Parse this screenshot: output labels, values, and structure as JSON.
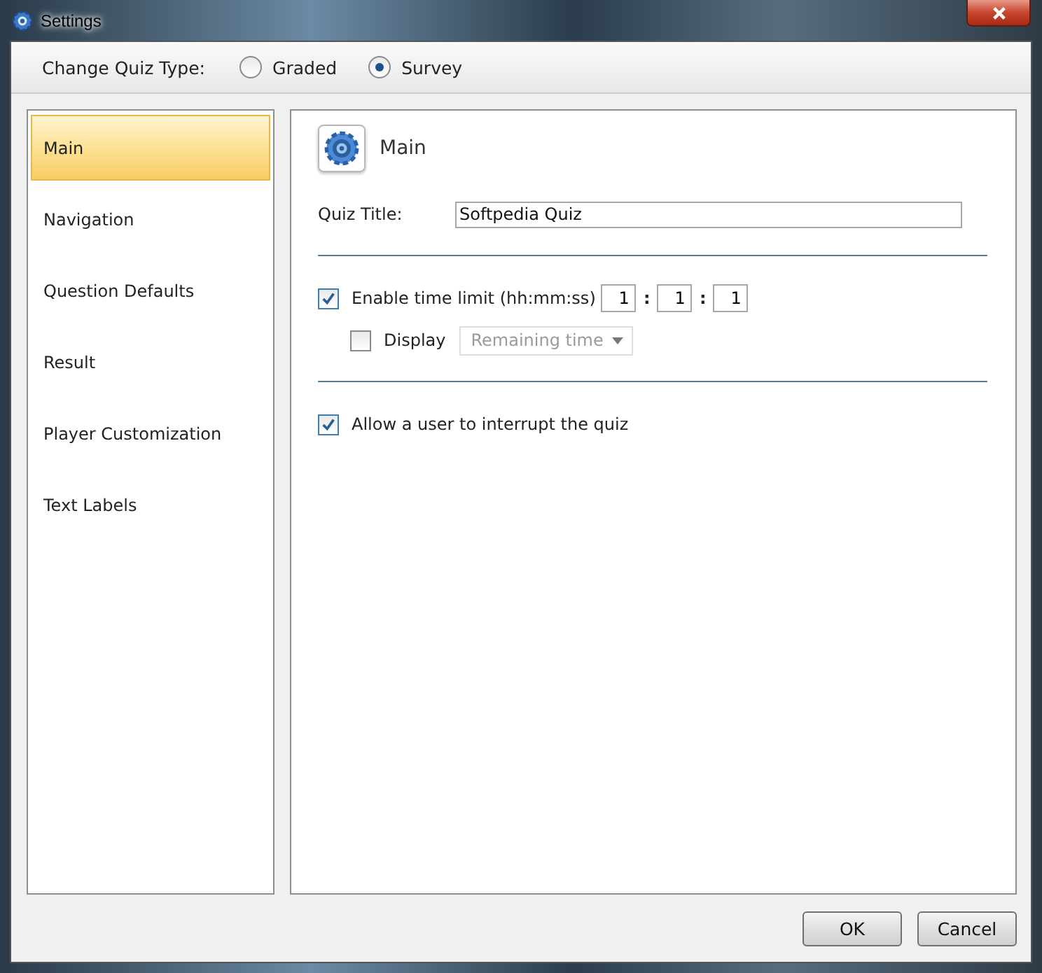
{
  "window": {
    "title": "Settings"
  },
  "quiz_type": {
    "label": "Change Quiz Type:",
    "options": [
      {
        "label": "Graded",
        "selected": false
      },
      {
        "label": "Survey",
        "selected": true
      }
    ]
  },
  "sidebar": {
    "items": [
      {
        "label": "Main",
        "selected": true
      },
      {
        "label": "Navigation",
        "selected": false
      },
      {
        "label": "Question Defaults",
        "selected": false
      },
      {
        "label": "Result",
        "selected": false
      },
      {
        "label": "Player Customization",
        "selected": false
      },
      {
        "label": "Text Labels",
        "selected": false
      }
    ]
  },
  "panel": {
    "title": "Main",
    "quiz_title": {
      "label": "Quiz Title:",
      "value": "Softpedia Quiz"
    },
    "time_limit": {
      "label": "Enable time limit (hh:mm:ss)",
      "checked": true,
      "fields": [
        "1",
        "1",
        "1"
      ],
      "separators": [
        ":",
        ":"
      ]
    },
    "display": {
      "label": "Display",
      "checked": false,
      "dropdown": {
        "value": "Remaining time",
        "disabled": true
      }
    },
    "interrupt": {
      "label": "Allow a user to interrupt the quiz",
      "checked": true
    }
  },
  "buttons": [
    "OK",
    "Cancel"
  ]
}
